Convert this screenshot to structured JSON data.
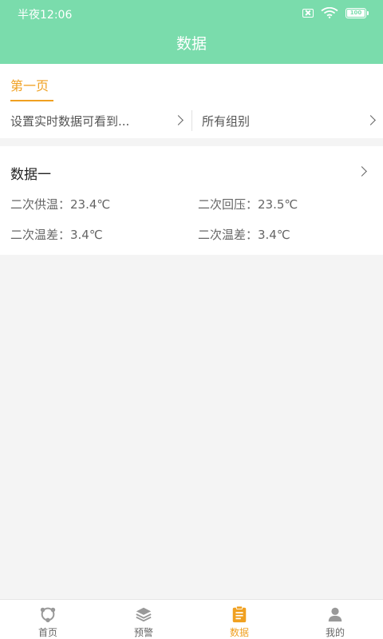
{
  "status_bar": {
    "time": "半夜12:06",
    "battery": "100"
  },
  "header": {
    "title": "数据"
  },
  "tabs": [
    {
      "label": "第一页",
      "active": true
    }
  ],
  "filters": {
    "left": "设置实时数据可看到...",
    "right": "所有组别"
  },
  "card": {
    "title": "数据一",
    "metrics": [
      "二次供温：23.4℃",
      "二次回压：23.5℃",
      "二次温差：3.4℃",
      "二次温差：3.4℃"
    ]
  },
  "tabbar": {
    "items": [
      {
        "label": "首页",
        "icon": "home-icon"
      },
      {
        "label": "预警",
        "icon": "layers-icon"
      },
      {
        "label": "数据",
        "icon": "clipboard-icon",
        "active": true
      },
      {
        "label": "我的",
        "icon": "person-icon"
      }
    ]
  },
  "colors": {
    "header": "#7adcac",
    "accent": "#f0a020",
    "background": "#f4f4f4"
  }
}
